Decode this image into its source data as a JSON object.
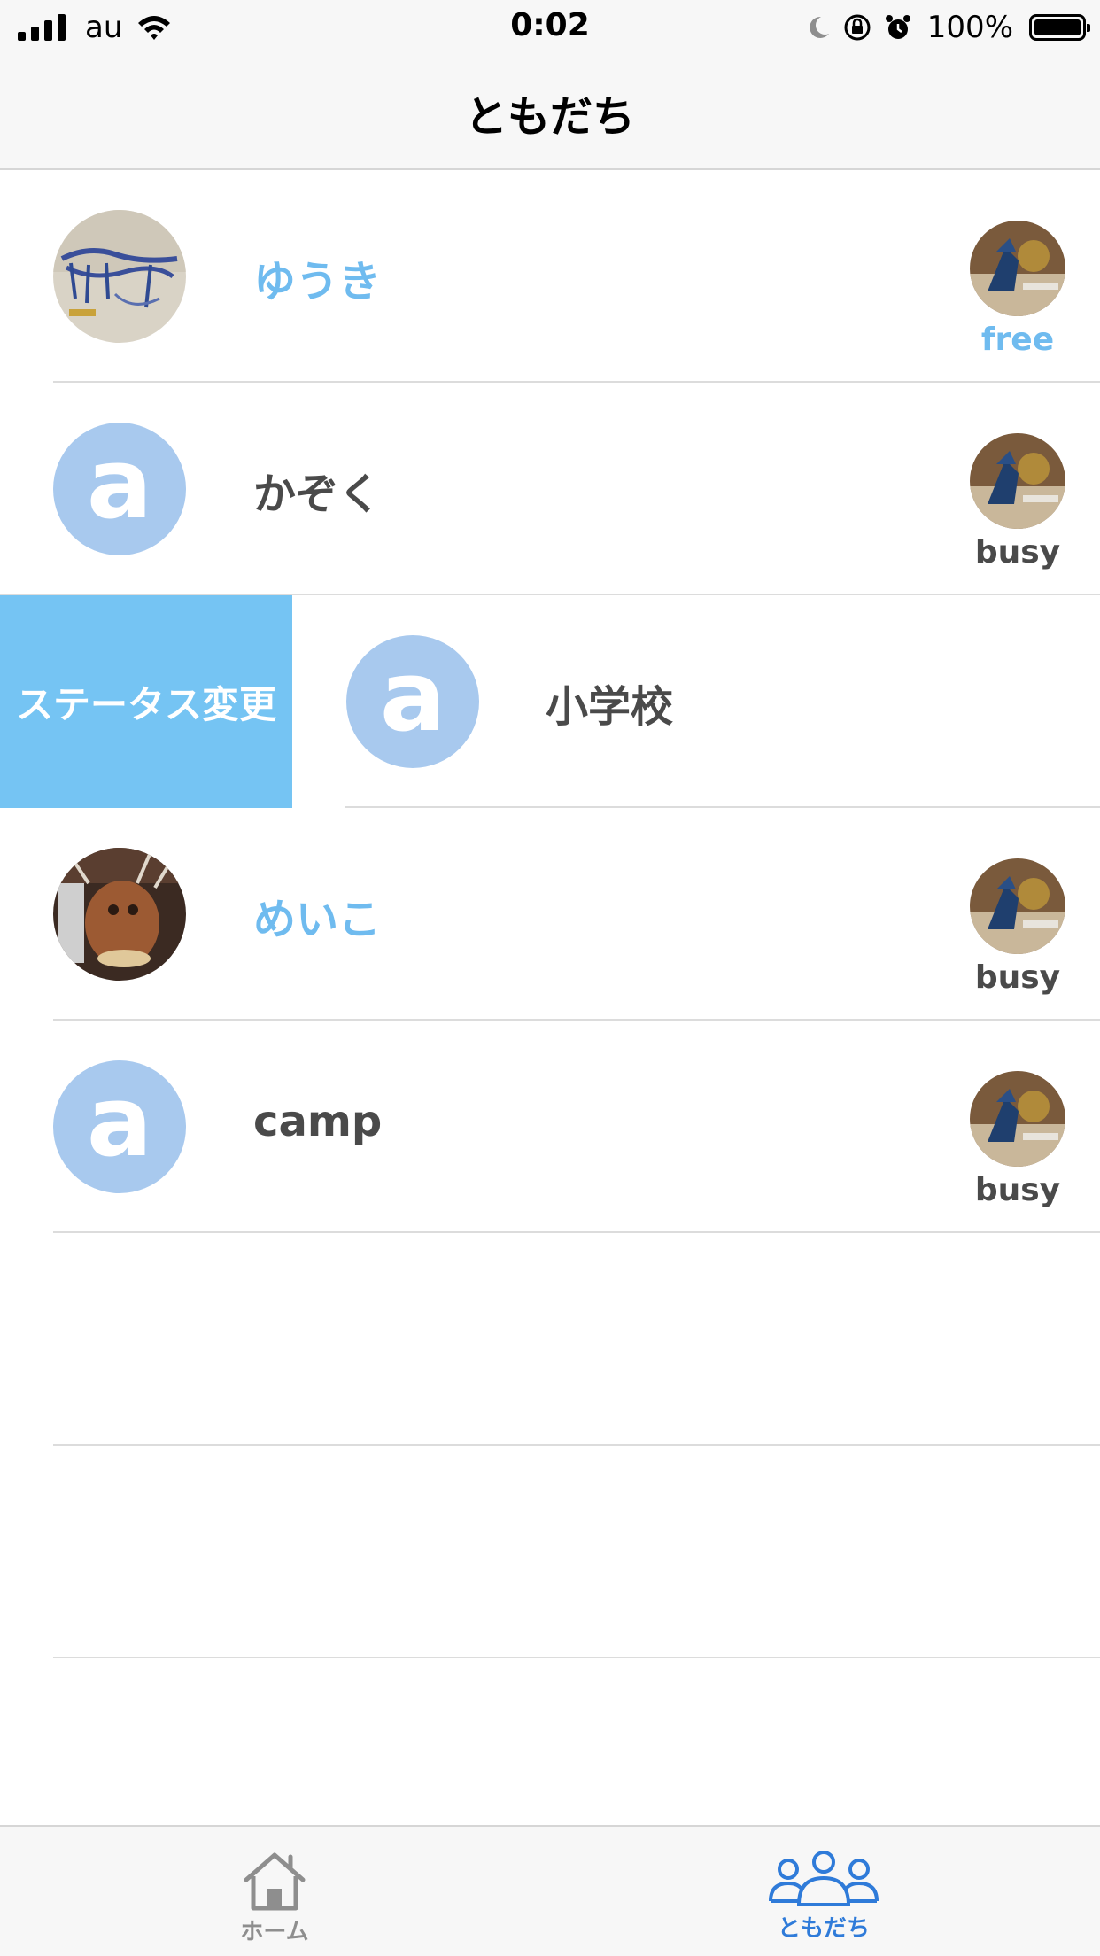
{
  "status_bar": {
    "carrier": "au",
    "time": "0:02",
    "battery_percent": "100%"
  },
  "nav": {
    "title": "ともだち"
  },
  "friends": [
    {
      "name": "ゆうき",
      "status": "free",
      "avatar": "photo",
      "highlight": true
    },
    {
      "name": "かぞく",
      "status": "busy",
      "avatar": "letter",
      "highlight": false
    },
    {
      "name": "小学校",
      "status": "",
      "avatar": "letter",
      "highlight": false,
      "swiped": true
    },
    {
      "name": "めいこ",
      "status": "busy",
      "avatar": "photo",
      "highlight": true
    },
    {
      "name": "camp",
      "status": "busy",
      "avatar": "letter",
      "highlight": false
    }
  ],
  "avatar_letter": "a",
  "swipe_action_label": "ステータス変更",
  "tabs": [
    {
      "label": "ホーム",
      "icon": "house-icon",
      "selected": false
    },
    {
      "label": "ともだち",
      "icon": "people-icon",
      "selected": true
    }
  ],
  "colors": {
    "accent": "#6fbbef",
    "swipe_action": "#75c4f3",
    "avatar_placeholder": "#a8c9ee",
    "tab_selected": "#2f7bd9",
    "tab_unselected": "#8e8e8e"
  }
}
